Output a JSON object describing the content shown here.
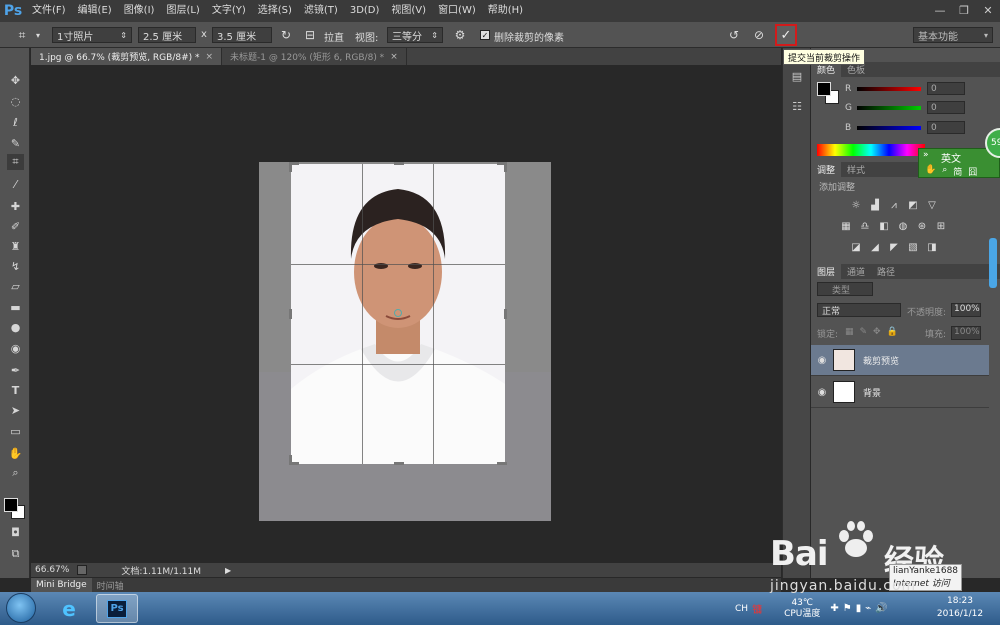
{
  "app": {
    "logo": "Ps"
  },
  "menu": [
    "文件(F)",
    "编辑(E)",
    "图像(I)",
    "图层(L)",
    "文字(Y)",
    "选择(S)",
    "滤镜(T)",
    "3D(D)",
    "视图(V)",
    "窗口(W)",
    "帮助(H)"
  ],
  "options": {
    "preset": "1寸照片",
    "width": "2.5 厘米",
    "x_sep": "x",
    "height": "3.5 厘米",
    "straighten": "拉直",
    "view_label": "视图:",
    "view_value": "三等分",
    "delete_cropped": "删除裁剪的像素",
    "workspace": "基本功能",
    "tooltip": "提交当前裁剪操作"
  },
  "tabs": [
    {
      "label": "1.jpg @ 66.7% (裁剪预览, RGB/8#) *",
      "close": "×"
    },
    {
      "label": "未标题-1 @ 120% (矩形 6, RGB/8) *",
      "close": "×"
    }
  ],
  "status": {
    "zoom": "66.67%",
    "doc": "文档:1.11M/1.11M"
  },
  "bottom_tabs": [
    "Mini Bridge",
    "时间轴"
  ],
  "color_panel": {
    "tabs": [
      "颜色",
      "色板"
    ],
    "r": {
      "label": "R",
      "value": "0"
    },
    "g": {
      "label": "G",
      "value": "0"
    },
    "b": {
      "label": "B",
      "value": "0"
    }
  },
  "adjust_panel": {
    "tabs": [
      "调整",
      "样式"
    ],
    "title": "添加调整"
  },
  "layers_panel": {
    "tabs": [
      "图层",
      "通道",
      "路径"
    ],
    "kind": "类型",
    "blend": "正常",
    "opacity_label": "不透明度:",
    "opacity": "100%",
    "lock_label": "锁定:",
    "fill_label": "填充:",
    "fill": "100%",
    "layers": [
      {
        "name": "裁剪预览",
        "selected": true
      },
      {
        "name": "背景",
        "selected": false
      }
    ]
  },
  "ime": {
    "label": "英文",
    "row2": [
      "简",
      "囧"
    ],
    "circle": "59"
  },
  "taskbar": {
    "tray_lang": "CH",
    "temp": "43℃",
    "temp_label": "CPU温度",
    "time": "18:23",
    "date": "2016/1/12"
  },
  "watermark": {
    "brand": "Bai",
    "brand2": "经验",
    "url": "jingyan.baidu.com",
    "user": "lianYanke1688",
    "user2": "Internet 访问"
  }
}
